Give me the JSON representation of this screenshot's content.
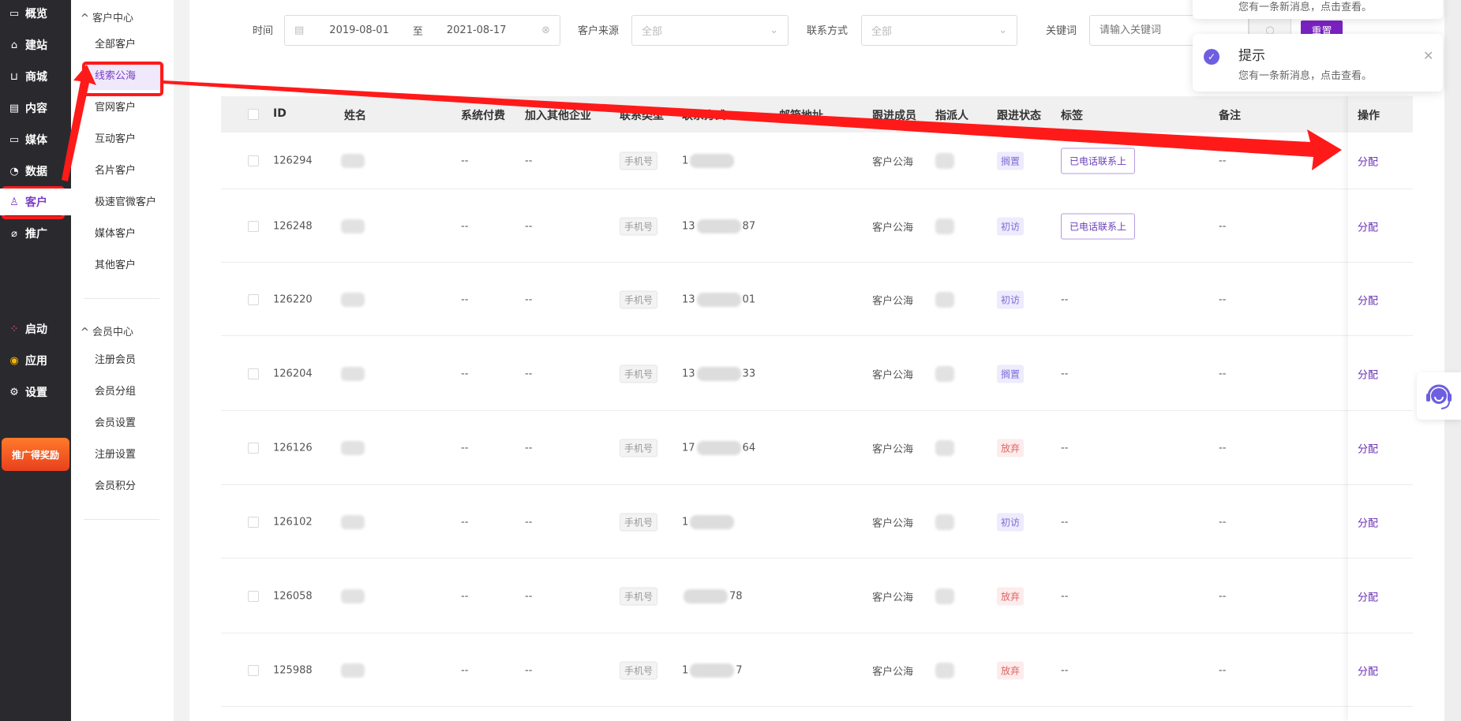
{
  "nav": {
    "items": [
      {
        "label": "概览",
        "icon": "monitor-icon"
      },
      {
        "label": "建站",
        "icon": "home-icon"
      },
      {
        "label": "商城",
        "icon": "cart-icon"
      },
      {
        "label": "内容",
        "icon": "document-icon"
      },
      {
        "label": "媒体",
        "icon": "video-icon"
      },
      {
        "label": "数据",
        "icon": "pie-chart-icon"
      },
      {
        "label": "客户",
        "icon": "user-icon",
        "active": true
      },
      {
        "label": "推广",
        "icon": "paperclip-icon"
      }
    ],
    "bottom": [
      {
        "label": "启动",
        "icon": "dots-icon"
      },
      {
        "label": "应用",
        "icon": "app-wheel-icon"
      },
      {
        "label": "设置",
        "icon": "gear-icon"
      }
    ],
    "banner": "推广得奖励"
  },
  "submenu": {
    "customer_center": {
      "title": "客户中心",
      "items": [
        "全部客户",
        "线索公海",
        "官网客户",
        "互动客户",
        "名片客户",
        "极速官微客户",
        "媒体客户",
        "其他客户"
      ],
      "active": "线索公海"
    },
    "member_center": {
      "title": "会员中心",
      "items": [
        "注册会员",
        "会员分组",
        "会员设置",
        "注册设置",
        "会员积分"
      ]
    }
  },
  "filters": {
    "time_label": "时间",
    "date_start": "2019-08-01",
    "date_sep": "至",
    "date_end": "2021-08-17",
    "source_label": "客户来源",
    "source_value": "全部",
    "contact_label": "联系方式",
    "contact_value": "全部",
    "keyword_label": "关键词",
    "keyword_placeholder": "请输入关键词",
    "reset": "重置"
  },
  "table": {
    "headers": [
      "ID",
      "姓名",
      "系统付费",
      "加入其他企业",
      "联系类型",
      "联系方式",
      "邮箱地址",
      "跟进成员",
      "指派人",
      "跟进状态",
      "标签",
      "备注",
      "操作"
    ],
    "rows": [
      {
        "id": "126294",
        "fee": "--",
        "join": "--",
        "ctype": "手机号",
        "phone_pre": "1",
        "phone_suf": "",
        "member": "客户公海",
        "status": "搁置",
        "tag": "已电话联系上",
        "note": "--",
        "op": "分配"
      },
      {
        "id": "126248",
        "fee": "--",
        "join": "--",
        "ctype": "手机号",
        "phone_pre": "13",
        "phone_suf": "87",
        "member": "客户公海",
        "status": "初访",
        "tag": "已电话联系上",
        "note": "--",
        "op": "分配"
      },
      {
        "id": "126220",
        "fee": "--",
        "join": "--",
        "ctype": "手机号",
        "phone_pre": "13",
        "phone_suf": "01",
        "member": "客户公海",
        "status": "初访",
        "tag": "--",
        "note": "--",
        "op": "分配"
      },
      {
        "id": "126204",
        "fee": "--",
        "join": "--",
        "ctype": "手机号",
        "phone_pre": "13",
        "phone_suf": "33",
        "member": "客户公海",
        "status": "搁置",
        "tag": "--",
        "note": "--",
        "op": "分配"
      },
      {
        "id": "126126",
        "fee": "--",
        "join": "--",
        "ctype": "手机号",
        "phone_pre": "17",
        "phone_suf": "64",
        "member": "客户公海",
        "status": "放弃",
        "tag": "--",
        "note": "--",
        "op": "分配"
      },
      {
        "id": "126102",
        "fee": "--",
        "join": "--",
        "ctype": "手机号",
        "phone_pre": "1",
        "phone_suf": "",
        "member": "客户公海",
        "status": "初访",
        "tag": "--",
        "note": "--",
        "op": "分配"
      },
      {
        "id": "126058",
        "fee": "--",
        "join": "--",
        "ctype": "手机号",
        "phone_pre": "",
        "phone_suf": "78",
        "member": "客户公海",
        "status": "放弃",
        "tag": "--",
        "note": "--",
        "op": "分配"
      },
      {
        "id": "125988",
        "fee": "--",
        "join": "--",
        "ctype": "手机号",
        "phone_pre": "1",
        "phone_suf": "7",
        "member": "客户公海",
        "status": "放弃",
        "tag": "--",
        "note": "--",
        "op": "分配"
      }
    ]
  },
  "toasts": [
    {
      "body": "您有一条新消息，点击查看。"
    },
    {
      "title": "提示",
      "body": "您有一条新消息，点击查看。"
    }
  ],
  "colors": {
    "accent": "#7b3fc4",
    "annotation": "#ff1a1a",
    "status_purple": "#7a6cd8",
    "status_red": "#e06262"
  }
}
